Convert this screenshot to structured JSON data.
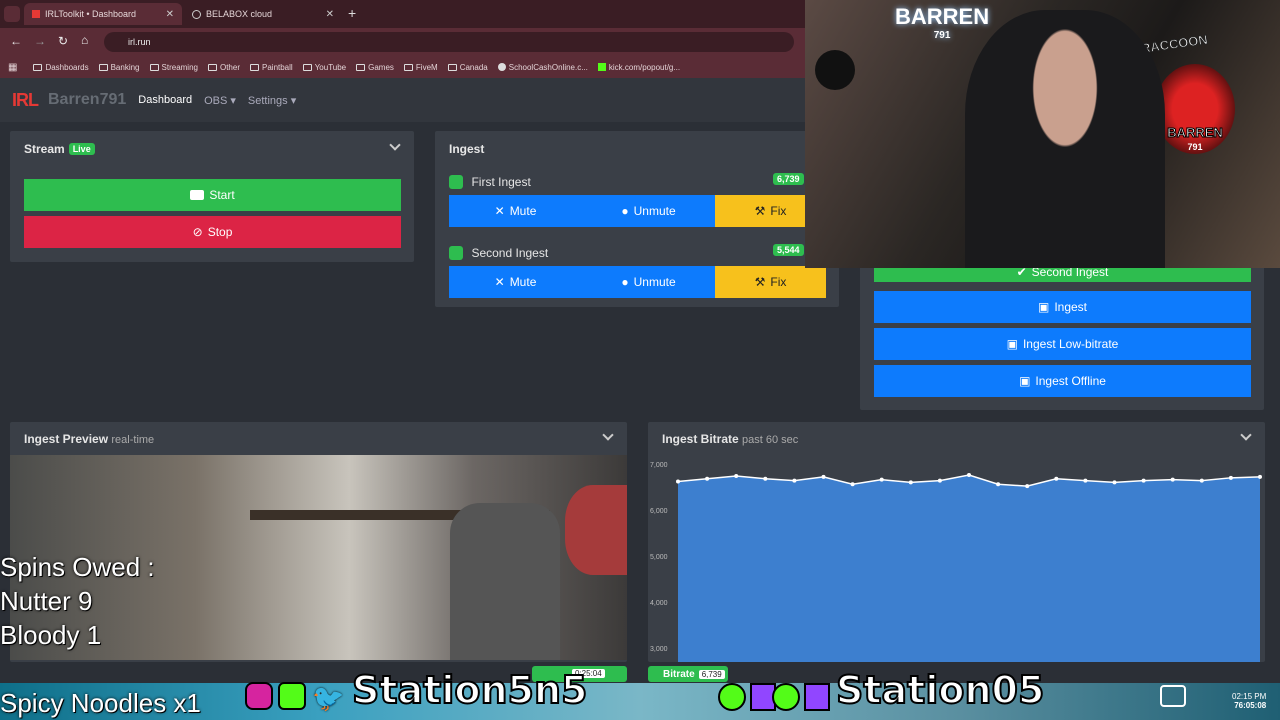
{
  "browser": {
    "tabs": [
      {
        "label": "IRLToolkit • Dashboard",
        "active": true
      },
      {
        "label": "BELABOX cloud",
        "active": false
      }
    ],
    "url": "irl.run",
    "bookmarks": [
      "Dashboards",
      "Banking",
      "Streaming",
      "Other",
      "Paintball",
      "YouTube",
      "Games",
      "FiveM",
      "Canada",
      "SchoolCashOnline.c...",
      "kick.com/popout/g..."
    ]
  },
  "nav": {
    "logo": "IRL",
    "brand": "Barren791",
    "links": [
      "Dashboard",
      "OBS",
      "Settings"
    ]
  },
  "stream": {
    "title": "Stream",
    "badge": "Live",
    "start_label": "Start",
    "stop_label": "Stop"
  },
  "ingest": {
    "title": "Ingest",
    "items": [
      {
        "name": "First Ingest",
        "bitrate": "6,739",
        "mute": "Mute",
        "unmute": "Unmute",
        "fix": "Fix"
      },
      {
        "name": "Second Ingest",
        "bitrate": "5,544",
        "mute": "Mute",
        "unmute": "Unmute",
        "fix": "Fix"
      }
    ]
  },
  "scenes": {
    "items": [
      "Second Ingest",
      "Ingest",
      "Ingest Low-bitrate",
      "Ingest Offline"
    ]
  },
  "preview": {
    "title": "Ingest Preview",
    "subtitle": "real-time"
  },
  "bitrate_panel": {
    "title": "Ingest Bitrate",
    "subtitle": "past 60 sec"
  },
  "chart_data": {
    "type": "area",
    "yticks": [
      "7,000",
      "6,000",
      "5,000",
      "4,000",
      "3,000"
    ],
    "ylim": [
      2700,
      7000
    ],
    "values": [
      6620,
      6680,
      6740,
      6680,
      6640,
      6720,
      6560,
      6660,
      6600,
      6640,
      6760,
      6560,
      6520,
      6680,
      6640,
      6600,
      6640,
      6660,
      6640,
      6700,
      6720
    ],
    "color": "#3d7fcf"
  },
  "statusbar": {
    "live_time": "0:25:04",
    "bitrate_label": "Bitrate",
    "bitrate_value": "6,739"
  },
  "overlay": {
    "spins_line1": "Spins Owed :",
    "spins_line2": "Nutter 9",
    "spins_line3": "Bloody 1",
    "noodles": "Spicy Noodles x1",
    "handle1": "Station5n5",
    "handle2": "Station05",
    "clock_time": "02:15 PM",
    "clock_date": "76:05:08"
  },
  "cam": {
    "sign1": "BARREN",
    "sign1_sub": "791",
    "sign2": "STARRYRACCOON",
    "sign3": "BARREN",
    "sign3_sub": "791"
  }
}
